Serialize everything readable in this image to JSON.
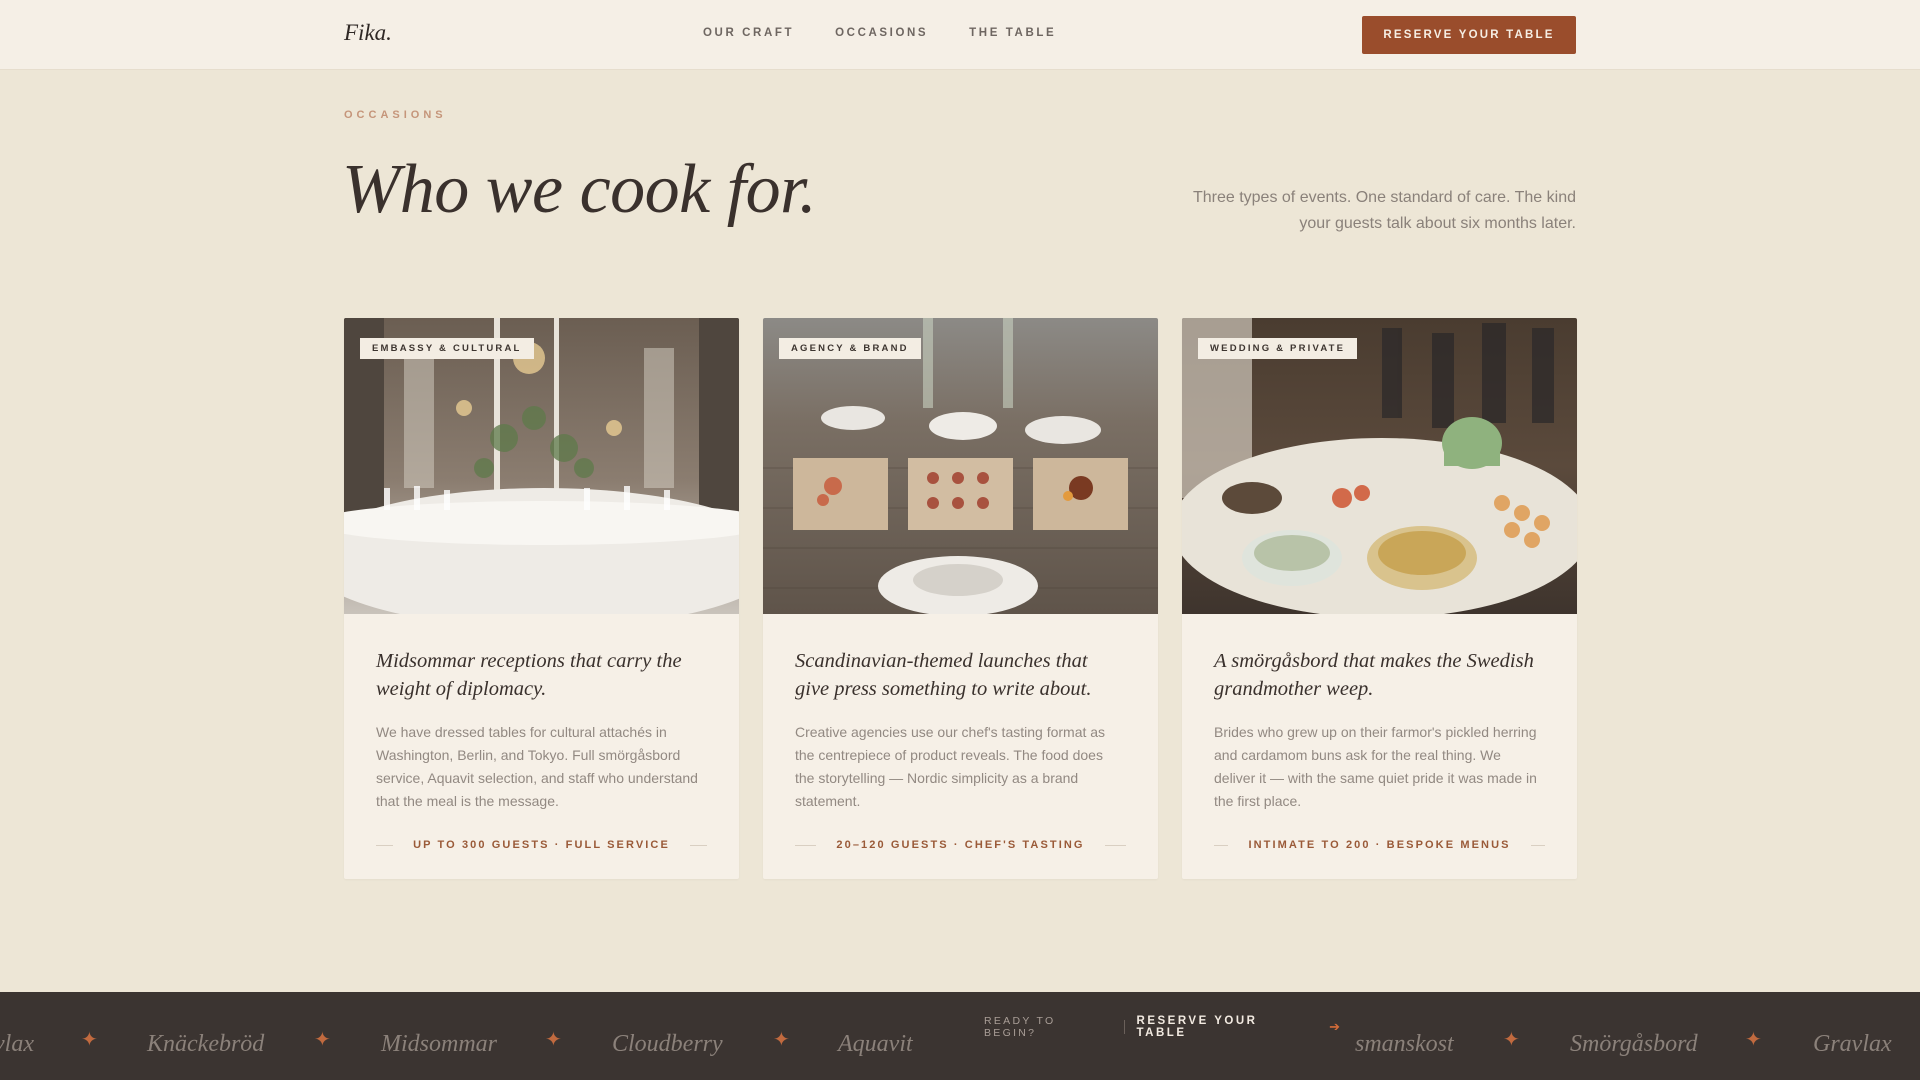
{
  "nav": {
    "logo": "Fika.",
    "links": [
      "OUR CRAFT",
      "OCCASIONS",
      "THE TABLE"
    ],
    "cta": "RESERVE YOUR TABLE"
  },
  "hero": {
    "eyebrow": "OCCASIONS",
    "title": "Who we cook for.",
    "intro": "Three types of events. One standard of care. The kind your guests talk about six months later."
  },
  "cards": [
    {
      "tag": "EMBASSY & CULTURAL",
      "title": "Midsommar receptions that carry the weight of diplomacy.",
      "text": "We have dressed tables for cultural attachés in Washington, Berlin, and Tokyo. Full smörgåsbord service, Aquavit selection, and staff who understand that the meal is the message.",
      "meta": "UP TO 300 GUESTS · FULL SERVICE",
      "image": "banquet-hall-photo"
    },
    {
      "tag": "AGENCY & BRAND",
      "title": "Scandinavian-themed launches that give press something to write about.",
      "text": "Creative agencies use our chef's tasting format as the centrepiece of product reveals. The food does the storytelling — Nordic simplicity as a brand statement.",
      "meta": "20–120 GUESTS · CHEF'S TASTING",
      "image": "tasting-table-photo"
    },
    {
      "tag": "WEDDING & PRIVATE",
      "title": "A smörgåsbord that makes the Swedish grandmother weep.",
      "text": "Brides who grew up on their farmor's pickled herring and cardamom buns ask for the real thing. We deliver it — with the same quiet pride it was made in the first place.",
      "meta": "INTIMATE TO 200 · BESPOKE MENUS",
      "image": "buffet-spread-photo"
    }
  ],
  "band": {
    "words_left": [
      "vlax",
      "Knäckebröd",
      "Midsommar",
      "Cloudberry",
      "Aquavit"
    ],
    "words_right": [
      "smanskost",
      "Smörgåsbord",
      "Gravlax"
    ],
    "cta_label": "READY TO BEGIN?",
    "cta_link": "RESERVE YOUR TABLE",
    "cta_icon": "arrow-right-icon"
  },
  "colors": {
    "background": "#ede6d6",
    "nav_bg": "#f5efe6",
    "accent": "#9a4d2c",
    "dark_band": "#3b3431",
    "star": "#c16a3f"
  }
}
